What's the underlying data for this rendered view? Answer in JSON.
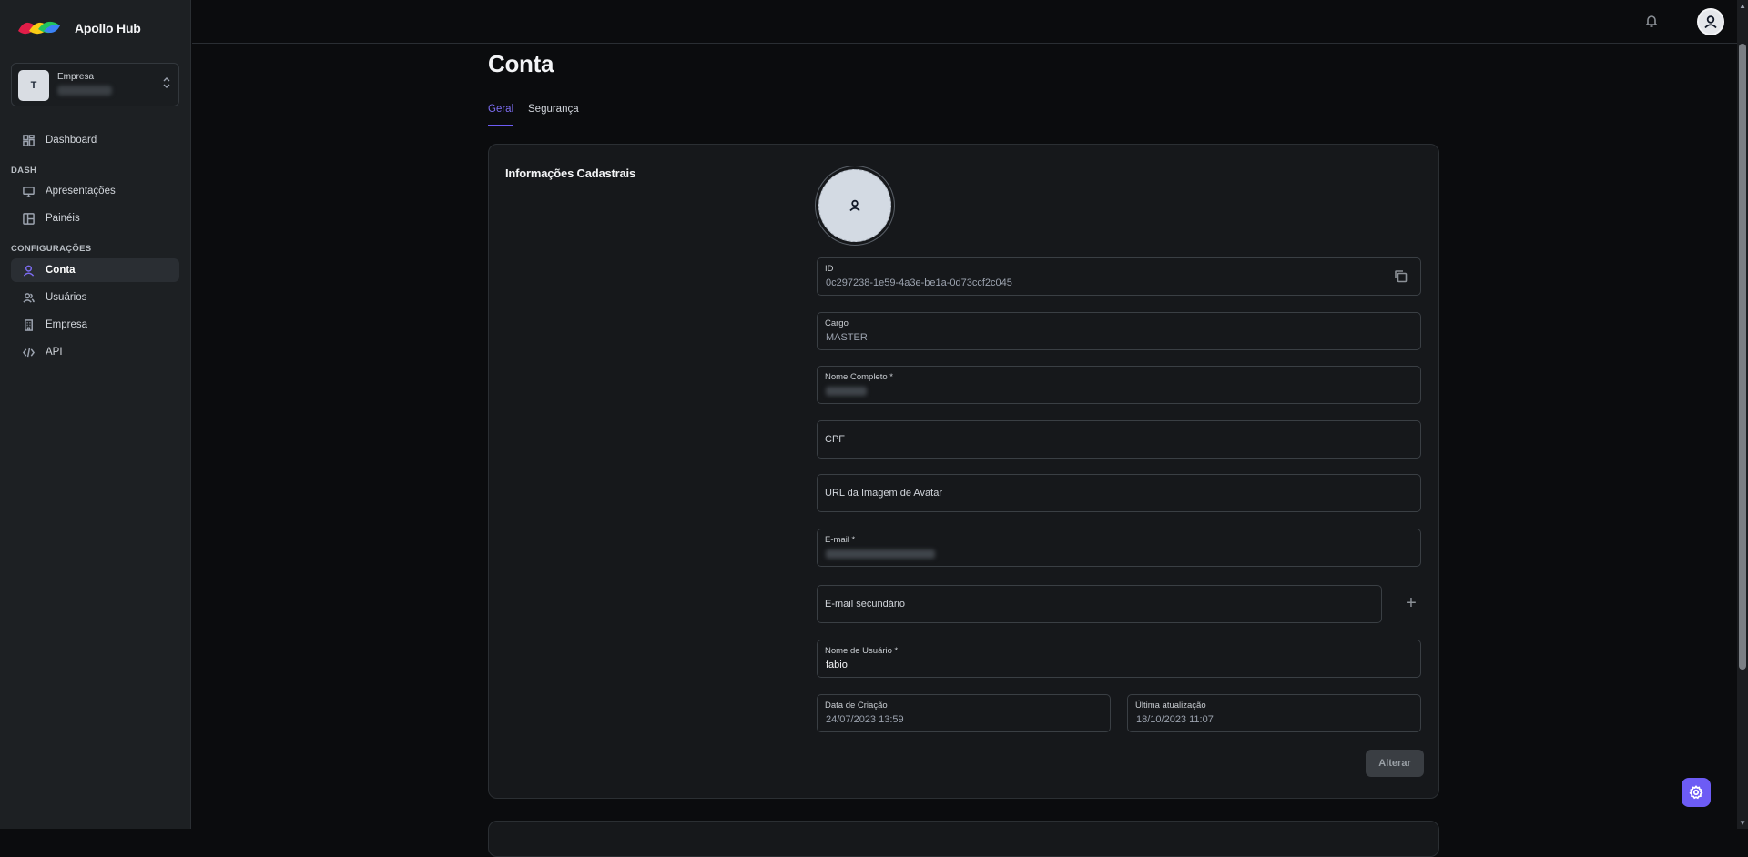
{
  "app": {
    "title": "Apollo Hub"
  },
  "company_switcher": {
    "avatar_letter": "T",
    "label": "Empresa"
  },
  "sidebar": {
    "dashboard": "Dashboard",
    "section_dash": "DASH",
    "apresentacoes": "Apresentações",
    "paineis": "Painéis",
    "section_config": "CONFIGURAÇÕES",
    "conta": "Conta",
    "usuarios": "Usuários",
    "empresa": "Empresa",
    "api": "API"
  },
  "page": {
    "title": "Conta",
    "tabs": [
      "Geral",
      "Segurança"
    ]
  },
  "card": {
    "title": "Informações Cadastrais",
    "fields": {
      "id_label": "ID",
      "id_value": "0c297238-1e59-4a3e-be1a-0d73ccf2c045",
      "cargo_label": "Cargo",
      "cargo_value": "MASTER",
      "nome_label": "Nome Completo *",
      "cpf_placeholder": "CPF",
      "avatar_url_placeholder": "URL da Imagem de Avatar",
      "email_label": "E-mail *",
      "email_secundario_placeholder": "E-mail secundário",
      "usuario_label": "Nome de Usuário *",
      "usuario_value": "fabio",
      "criacao_label": "Data de Criação",
      "criacao_value": "24/07/2023 13:59",
      "atualizacao_label": "Última atualização",
      "atualizacao_value": "18/10/2023 11:07"
    },
    "save_label": "Alterar"
  },
  "colors": {
    "accent": "#6d5cf5",
    "sidebar_bg": "#1d2023",
    "page_bg": "#0b0c0e"
  },
  "icons": [
    "logo",
    "chevrons-updown-icon",
    "dashboard-icon",
    "monitor-icon",
    "layout-icon",
    "user-icon",
    "users-icon",
    "building-icon",
    "code-icon",
    "bell-icon",
    "avatar-icon",
    "copy-icon",
    "plus-icon",
    "settings-icon"
  ]
}
